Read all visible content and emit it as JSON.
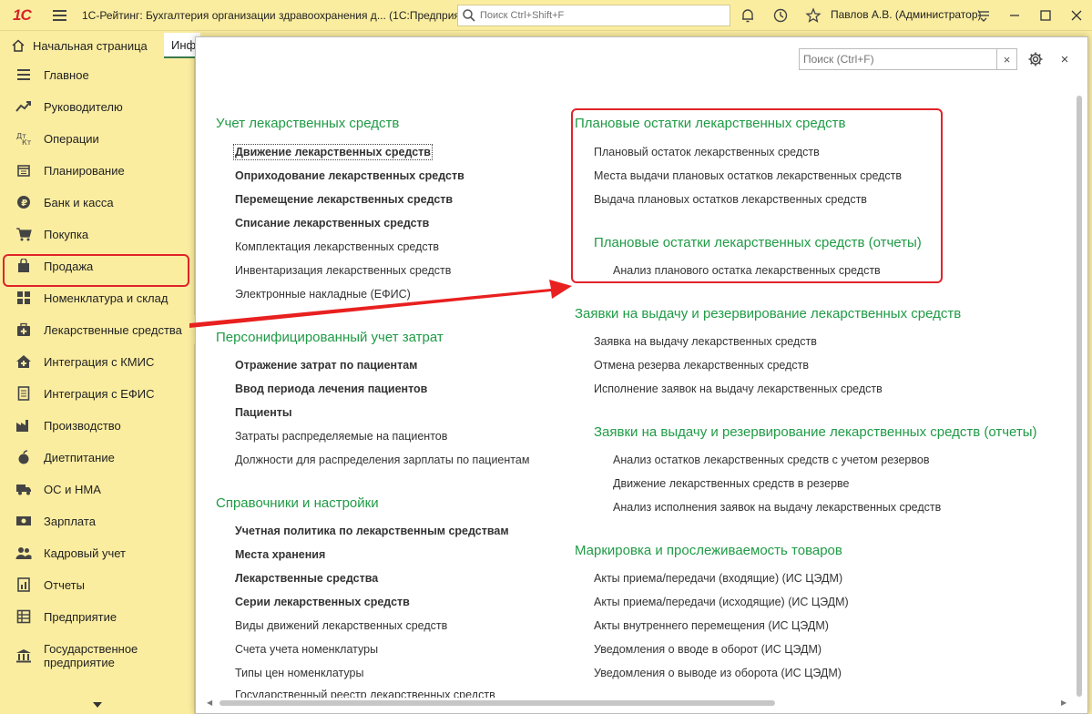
{
  "titlebar": {
    "logo": "1С",
    "title": "1С-Рейтинг: Бухгалтерия организации здравоохранения д...  (1С:Предприятие)",
    "search_placeholder": "Поиск Ctrl+Shift+F",
    "user": "Павлов А.В. (Администратор)"
  },
  "tabs": {
    "home": "Начальная страница",
    "info": "Инфо"
  },
  "sidebar": {
    "items": [
      {
        "label": "Главное",
        "icon": "menu-lines-icon"
      },
      {
        "label": "Руководителю",
        "icon": "trend-icon"
      },
      {
        "label": "Операции",
        "icon": "dt-kt-icon"
      },
      {
        "label": "Планирование",
        "icon": "calendar-icon"
      },
      {
        "label": "Банк и касса",
        "icon": "coin-icon"
      },
      {
        "label": "Покупка",
        "icon": "cart-icon"
      },
      {
        "label": "Продажа",
        "icon": "bag-icon"
      },
      {
        "label": "Номенклатура и склад",
        "icon": "grid-icon"
      },
      {
        "label": "Лекарственные средства",
        "icon": "medkit-icon"
      },
      {
        "label": "Интеграция с КМИС",
        "icon": "house-icon"
      },
      {
        "label": "Интеграция с ЕФИС",
        "icon": "document-icon"
      },
      {
        "label": "Производство",
        "icon": "factory-icon"
      },
      {
        "label": "Диетпитание",
        "icon": "apple-icon"
      },
      {
        "label": "ОС и НМА",
        "icon": "truck-icon"
      },
      {
        "label": "Зарплата",
        "icon": "money-icon"
      },
      {
        "label": "Кадровый учет",
        "icon": "people-icon"
      },
      {
        "label": "Отчеты",
        "icon": "report-icon"
      },
      {
        "label": "Предприятие",
        "icon": "table-icon"
      },
      {
        "label": "Государственное предприятие",
        "icon": "government-icon"
      }
    ]
  },
  "panel": {
    "search_placeholder": "Поиск (Ctrl+F)",
    "left": {
      "sections": [
        {
          "title": "Учет лекарственных средств",
          "links": [
            {
              "label": "Движение лекарственных средств",
              "bold": true
            },
            {
              "label": "Оприходование лекарственных средств",
              "bold": true
            },
            {
              "label": "Перемещение лекарственных средств",
              "bold": true
            },
            {
              "label": "Списание лекарственных средств",
              "bold": true
            },
            {
              "label": "Комплектация лекарственных средств",
              "bold": false
            },
            {
              "label": "Инвентаризация лекарственных средств",
              "bold": false
            },
            {
              "label": "Электронные накладные (ЕФИС)",
              "bold": false
            }
          ]
        },
        {
          "title": "Персонифицированный учет затрат",
          "links": [
            {
              "label": "Отражение затрат по пациентам",
              "bold": true
            },
            {
              "label": "Ввод периода лечения пациентов",
              "bold": true
            },
            {
              "label": "Пациенты",
              "bold": true
            },
            {
              "label": "Затраты распределяемые на пациентов",
              "bold": false
            },
            {
              "label": "Должности для распределения зарплаты по пациентам",
              "bold": false
            }
          ]
        },
        {
          "title": "Справочники и настройки",
          "links": [
            {
              "label": "Учетная политика по лекарственным средствам",
              "bold": true
            },
            {
              "label": "Места хранения",
              "bold": true
            },
            {
              "label": "Лекарственные средства",
              "bold": true
            },
            {
              "label": "Серии лекарственных средств",
              "bold": true
            },
            {
              "label": "Виды движений лекарственных средств",
              "bold": false
            },
            {
              "label": "Счета учета номенклатуры",
              "bold": false
            },
            {
              "label": "Типы цен номенклатуры",
              "bold": false
            },
            {
              "label": "Государственный реестр лекарственных средств",
              "bold": false
            }
          ]
        }
      ]
    },
    "right": {
      "sections": [
        {
          "title": "Плановые остатки лекарственных средств",
          "links": [
            "Плановый остаток лекарственных средств",
            "Места выдачи плановых остатков лекарственных средств",
            "Выдача плановых остатков лекарственных средств"
          ]
        },
        {
          "title": "Плановые остатки лекарственных средств (отчеты)",
          "links": [
            "Анализ планового остатка лекарственных средств"
          ]
        },
        {
          "title": "Заявки на выдачу и  резервирование лекарственных средств",
          "links": [
            "Заявка на выдачу лекарственных средств",
            "Отмена резерва лекарственных средств",
            "Исполнение заявок на выдачу лекарственных средств"
          ]
        },
        {
          "title": "Заявки на выдачу и  резервирование лекарственных средств (отчеты)",
          "links": [
            "Анализ остатков лекарственных средств с учетом резервов",
            "Движение лекарственных средств в резерве",
            "Анализ исполнения заявок на выдачу лекарственных средств"
          ]
        },
        {
          "title": "Маркировка и прослеживаемость товаров",
          "links": [
            "Акты приема/передачи (входящие) (ИС ЦЭДМ)",
            "Акты приема/передачи (исходящие) (ИС ЦЭДМ)",
            "Акты внутреннего перемещения (ИС ЦЭДМ)",
            "Уведомления о вводе в оборот (ИС ЦЭДМ)",
            "Уведомления о выводе из оборота (ИС ЦЭДМ)"
          ]
        }
      ]
    }
  },
  "colors": {
    "sidebar_bg": "#fbeda0",
    "section_title": "#1f9b45",
    "highlight": "#e0232a"
  }
}
